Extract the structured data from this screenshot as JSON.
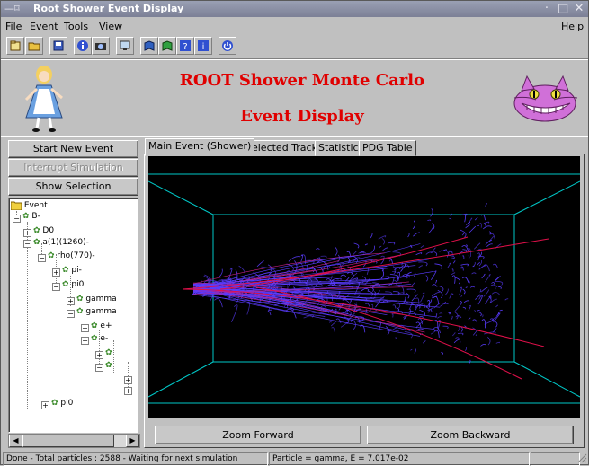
{
  "window": {
    "title": "Root Shower Event Display",
    "sys_menu": "—⌑",
    "controls": [
      "·",
      "□",
      "✕"
    ]
  },
  "menu": {
    "file": "File",
    "event": "Event",
    "tools": "Tools",
    "view": "View",
    "help": "Help"
  },
  "banner": {
    "line1": "ROOT Shower Monte Carlo",
    "line2": "Event Display"
  },
  "buttons": {
    "start": "Start New Event",
    "interrupt": "Interrupt Simulation",
    "show": "Show Selection"
  },
  "tree": [
    {
      "label": "Event",
      "depth": 0
    },
    {
      "label": "B-",
      "depth": 1
    },
    {
      "label": "D0",
      "depth": 2
    },
    {
      "label": "a(1)(1260)-",
      "depth": 2
    },
    {
      "label": "rho(770)-",
      "depth": 3
    },
    {
      "label": "pi-",
      "depth": 4
    },
    {
      "label": "pi0",
      "depth": 4
    },
    {
      "label": "gamma",
      "depth": 5
    },
    {
      "label": "gamma",
      "depth": 5
    },
    {
      "label": "e+",
      "depth": 6
    },
    {
      "label": "e-",
      "depth": 6
    },
    {
      "label": "",
      "depth": 7
    },
    {
      "label": "",
      "depth": 7
    },
    {
      "label": "",
      "depth": 8
    },
    {
      "label": "",
      "depth": 8
    },
    {
      "label": "pi0",
      "depth": 2
    }
  ],
  "tabs": [
    "Main Event (Shower)",
    "Selected Track",
    "Statistics",
    "PDG Table"
  ],
  "zoom": {
    "forward": "Zoom Forward",
    "backward": "Zoom Backward"
  },
  "status": {
    "left": "Done - Total particles : 2588 - Waiting for next simulation",
    "right": "Particle = gamma, E = 7.017e-02"
  },
  "colors": {
    "banner_text": "#e00000",
    "canvas_bg": "#000000",
    "box_lines": "#00c8c8",
    "shower": "#5a3cff",
    "track": "#e0104a"
  }
}
